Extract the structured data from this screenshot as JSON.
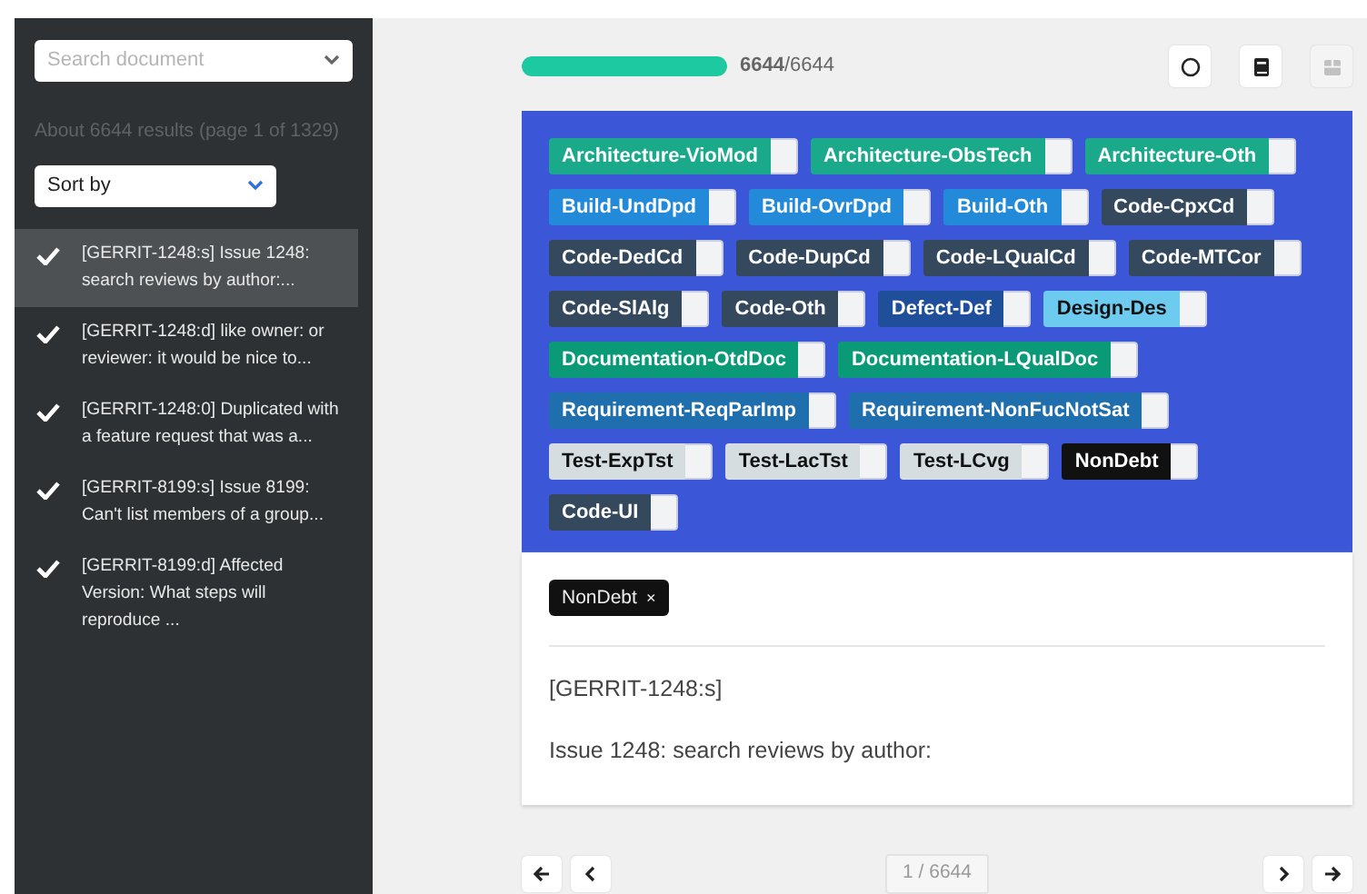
{
  "sidebar": {
    "search": {
      "placeholder": "Search document"
    },
    "results_summary": "About 6644 results (page 1 of 1329)",
    "sort": {
      "value": "Sort by"
    },
    "items": [
      {
        "text": "[GERRIT-1248:s] Issue 1248: search reviews by author:...",
        "checked": true,
        "selected": true
      },
      {
        "text": "[GERRIT-1248:d] like owner: or reviewer: it would be nice to...",
        "checked": true,
        "selected": false
      },
      {
        "text": "[GERRIT-1248:0] Duplicated with a feature request that was a...",
        "checked": true,
        "selected": false
      },
      {
        "text": "[GERRIT-8199:s] Issue 8199: Can't list members of a group...",
        "checked": true,
        "selected": false
      },
      {
        "text": "[GERRIT-8199:d] Affected Version: What steps will reproduce ...",
        "checked": true,
        "selected": false
      }
    ]
  },
  "progress": {
    "level": 1,
    "done": "6644",
    "total": "/6644"
  },
  "toolbar": [
    {
      "kind": "circle",
      "disabled": false
    },
    {
      "kind": "book",
      "disabled": false
    },
    {
      "kind": "box",
      "disabled": true
    }
  ],
  "labels": [
    {
      "text": "Architecture-VioMod",
      "color": "#1aa98a"
    },
    {
      "text": "Architecture-ObsTech",
      "color": "#1aa98a"
    },
    {
      "text": "Architecture-Oth",
      "color": "#1aa98a"
    },
    {
      "text": "Build-UndDpd",
      "color": "#2389d9"
    },
    {
      "text": "Build-OvrDpd",
      "color": "#2389d9"
    },
    {
      "text": "Build-Oth",
      "color": "#2389d9"
    },
    {
      "text": "Code-CpxCd",
      "color": "#34495e"
    },
    {
      "text": "Code-DedCd",
      "color": "#34495e"
    },
    {
      "text": "Code-DupCd",
      "color": "#34495e"
    },
    {
      "text": "Code-LQualCd",
      "color": "#34495e"
    },
    {
      "text": "Code-MTCor",
      "color": "#34495e"
    },
    {
      "text": "Code-SlAlg",
      "color": "#34495e"
    },
    {
      "text": "Code-Oth",
      "color": "#34495e"
    },
    {
      "text": "Defect-Def",
      "color": "#1f4f9a"
    },
    {
      "text": "Design-Des",
      "color": "#6ccbee"
    },
    {
      "text": "Documentation-OtdDoc",
      "color": "#0a9a78"
    },
    {
      "text": "Documentation-LQualDoc",
      "color": "#0a9a78"
    },
    {
      "text": "Requirement-ReqParImp",
      "color": "#1f6fae"
    },
    {
      "text": "Requirement-NonFucNotSat",
      "color": "#1f6fae"
    },
    {
      "text": "Test-ExpTst",
      "color": "#d5dde1"
    },
    {
      "text": "Test-LacTst",
      "color": "#d5dde1"
    },
    {
      "text": "Test-LCvg",
      "color": "#d5dde1"
    },
    {
      "text": "NonDebt",
      "color": "#111111"
    },
    {
      "text": "Code-UI",
      "color": "#34495e"
    }
  ],
  "selected_labels": [
    {
      "text": "NonDebt",
      "remove": "×"
    }
  ],
  "document": {
    "id": "[GERRIT-1248:s]",
    "body": "Issue 1248: search reviews by author:"
  },
  "pager": {
    "position": "1 / 6644"
  }
}
